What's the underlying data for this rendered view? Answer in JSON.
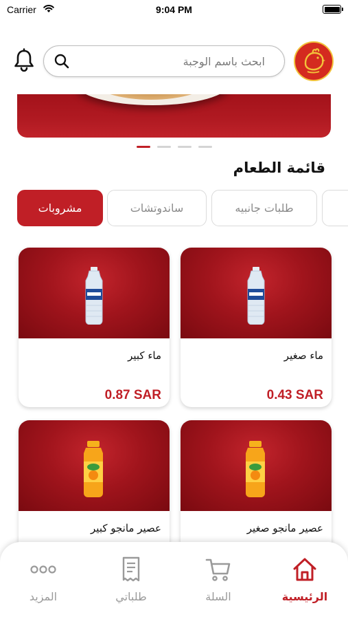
{
  "status_bar": {
    "carrier": "Carrier",
    "time": "9:04 PM"
  },
  "header": {
    "search_placeholder": "ابحث باسم الوجبة",
    "icons": {
      "bell": "bell-icon",
      "search": "search-icon",
      "logo": "brand-logo"
    }
  },
  "banner": {
    "slide_count": 4,
    "active_slide": 1
  },
  "menu": {
    "title": "قائمة الطعام",
    "categories": [
      {
        "label": "مشروبات",
        "active": true
      },
      {
        "label": "ساندوتشات",
        "active": false
      },
      {
        "label": "طلبات جانبيه",
        "active": false
      },
      {
        "label": "",
        "active": false
      }
    ]
  },
  "products": [
    {
      "name": "ماء صغير",
      "price": "0.43 SAR",
      "image": "water-bottle"
    },
    {
      "name": "ماء كبير",
      "price": "0.87 SAR",
      "image": "water-bottle"
    },
    {
      "name": "عصير مانجو صغير",
      "price": "",
      "image": "mango-juice-bottle"
    },
    {
      "name": "عصير مانجو كبير",
      "price": "",
      "image": "mango-juice-bottle"
    }
  ],
  "bottom_nav": [
    {
      "label": "الرئيسية",
      "icon": "home-icon",
      "active": true
    },
    {
      "label": "السلة",
      "icon": "cart-icon",
      "active": false
    },
    {
      "label": "طلباتي",
      "icon": "receipt-icon",
      "active": false
    },
    {
      "label": "المزيد",
      "icon": "more-icon",
      "active": false
    }
  ],
  "colors": {
    "accent": "#c01f26",
    "inactive": "#9a9a9a",
    "banner": "#a3121a"
  }
}
